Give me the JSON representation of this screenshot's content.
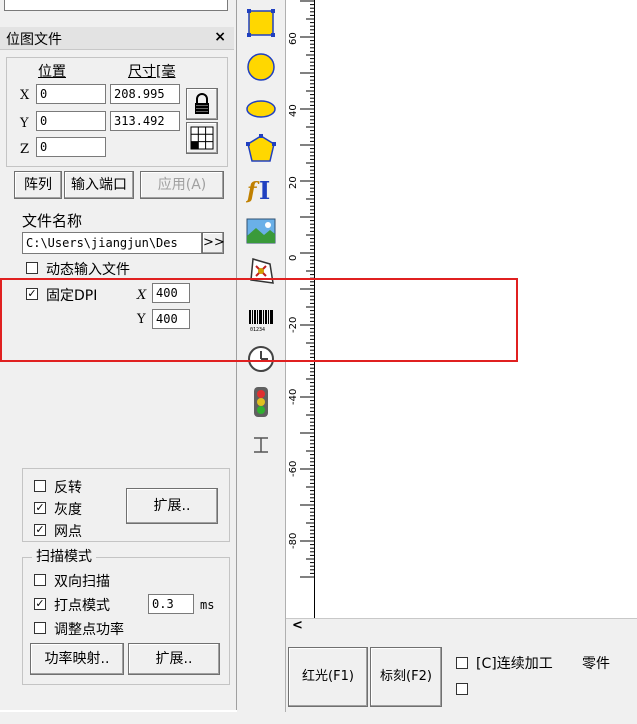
{
  "panel": {
    "title": "位图文件",
    "close_label": "×",
    "position_header": "位置",
    "size_header": "尺寸[毫",
    "x_label": "X",
    "y_label": "Y",
    "z_label": "Z",
    "x_value": "0",
    "y_value": "0",
    "z_value": "0",
    "width_value": "208.995",
    "height_value": "313.492"
  },
  "actions": {
    "array": "阵列",
    "input_port": "输入端口",
    "apply": "应用(A)"
  },
  "file": {
    "label": "文件名称",
    "path": "C:\\Users\\jiangjun\\Des",
    "browse": ">>",
    "dynamic_input": "动态输入文件",
    "fixed_dpi": "固定DPI",
    "dpi_x_label": "X",
    "dpi_y_label": "Y",
    "dpi_x": "400",
    "dpi_y": "400"
  },
  "image_opts": {
    "invert": "反转",
    "grayscale": "灰度",
    "dither": "网点",
    "extend": "扩展.."
  },
  "scan": {
    "title": "扫描模式",
    "bidirectional": "双向扫描",
    "dot_mode": "打点模式",
    "dot_value": "0.3",
    "dot_unit": "ms",
    "adjust_power": "调整点功率",
    "power_map": "功率映射..",
    "extend": "扩展.."
  },
  "ruler": {
    "labels": [
      "60",
      "40",
      "20",
      "0",
      "-20",
      "-40",
      "-60",
      "-80"
    ]
  },
  "bottom": {
    "red_light": "红光(F1)",
    "mark": "标刻(F2)",
    "continuous": "[C]连续加工",
    "parts": "零件"
  },
  "scroll": {
    "left_arrow": "<"
  },
  "colors": {
    "highlight": "#e02020",
    "shape_fill": "#ffd700",
    "shape_stroke": "#3050c0"
  }
}
